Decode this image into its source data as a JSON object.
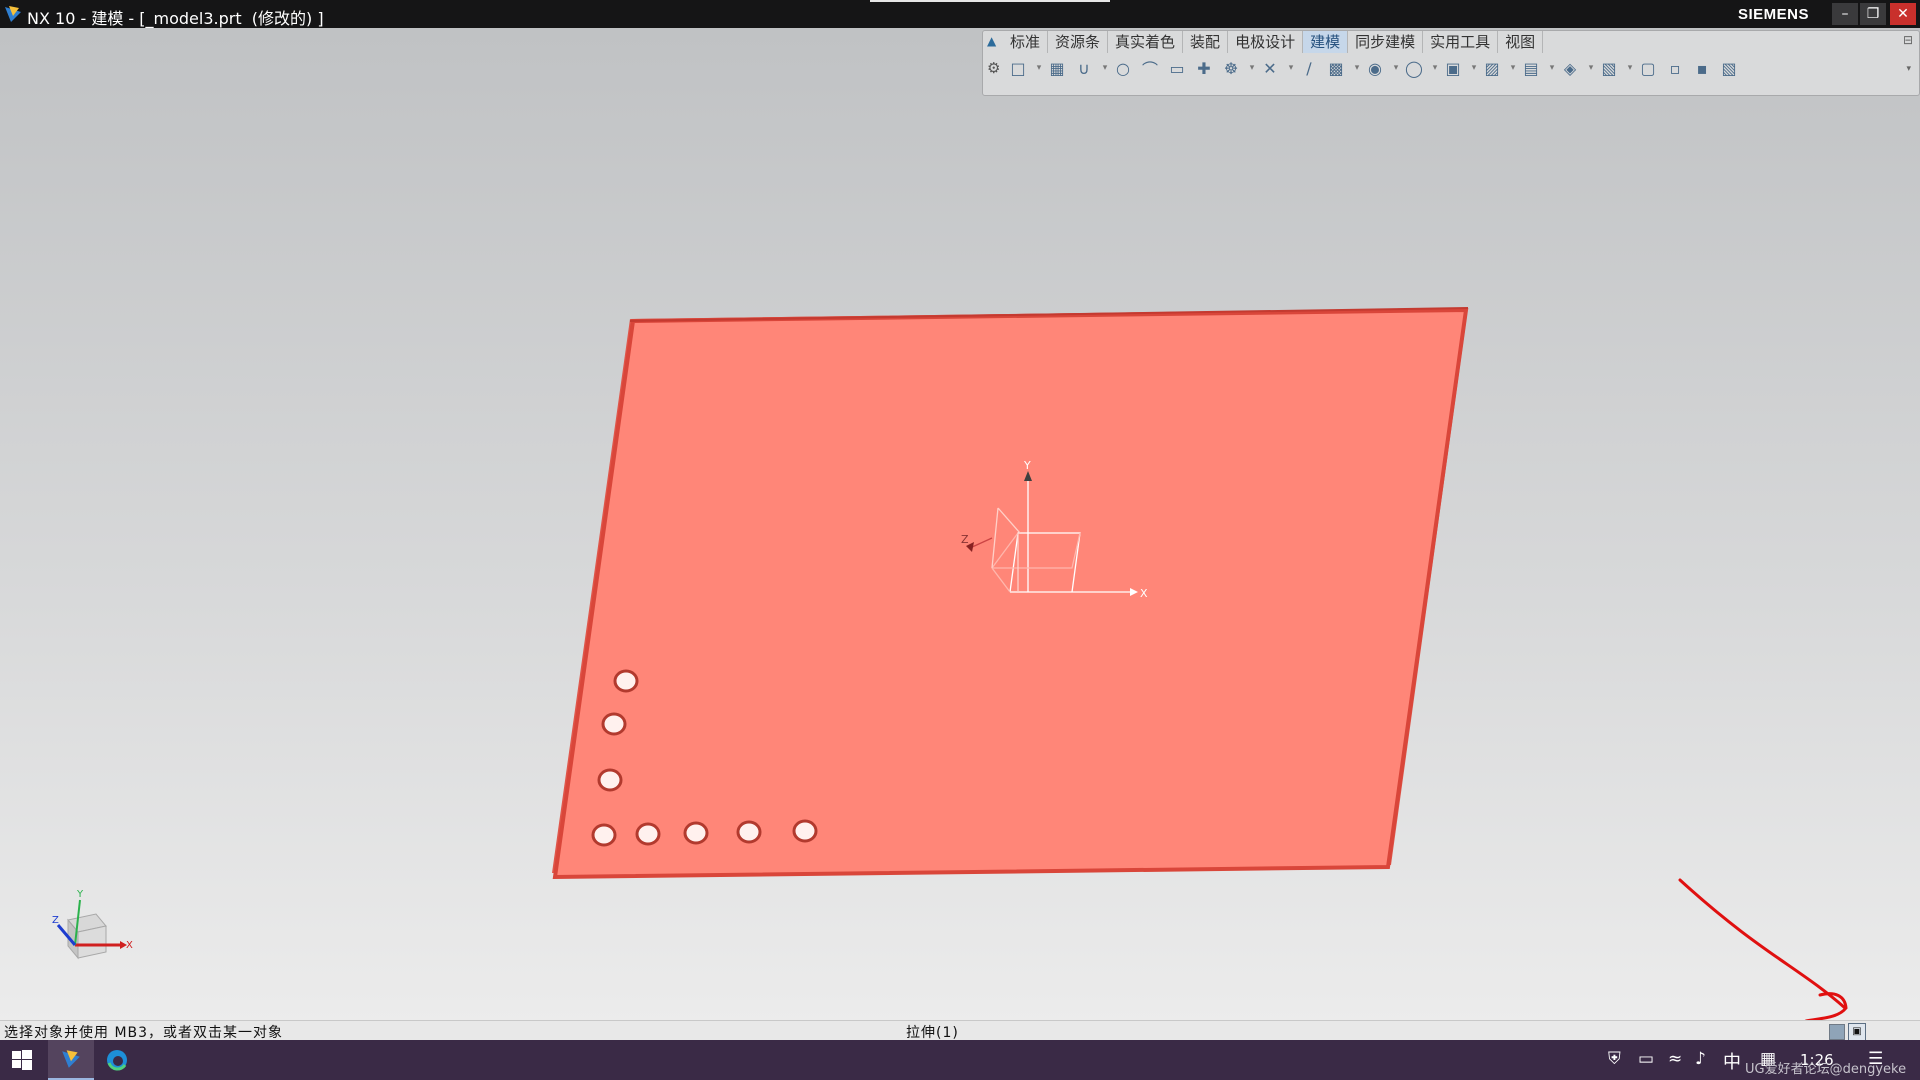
{
  "titlebar": {
    "title": "NX 10 - 建模 - [_model3.prt  (修改的) ]",
    "brand": "SIEMENS",
    "minimize_icon": "minimize-icon",
    "restore_icon": "restore-icon",
    "close_icon": "close-icon"
  },
  "ribbon": {
    "tabs": [
      {
        "label": "标准",
        "active": false
      },
      {
        "label": "资源条",
        "active": false
      },
      {
        "label": "真实着色",
        "active": false
      },
      {
        "label": "装配",
        "active": false
      },
      {
        "label": "电极设计",
        "active": false
      },
      {
        "label": "建模",
        "active": true
      },
      {
        "label": "同步建模",
        "active": false
      },
      {
        "label": "实用工具",
        "active": false
      },
      {
        "label": "视图",
        "active": false
      }
    ],
    "tools": [
      "sketch-icon",
      "datum-icon",
      "arc-icon",
      "circle-icon",
      "fillet-curve-icon",
      "rectangle-icon",
      "point-icon",
      "pattern-icon",
      "trim-icon",
      "sweep-icon",
      "extrude-icon",
      "revolve-icon",
      "hole-icon",
      "boss-icon",
      "block-icon",
      "cylinder-icon",
      "chamfer-icon",
      "shell-icon",
      "unite-icon",
      "subtract-icon",
      "offset-face-icon",
      "draft-icon"
    ]
  },
  "viewport": {
    "plate_color": "#ff8678",
    "plate_edge_color": "#d9463a",
    "wcs_labels": {
      "x": "X",
      "y": "Y",
      "z": "Z"
    },
    "triad_labels": {
      "x": "X",
      "y": "Y",
      "z": "Z"
    },
    "hole_count": 8,
    "annotation_color": "#e01010"
  },
  "statusbar": {
    "prompt": "选择对象并使用 MB3，或者双击某一对象",
    "message": "拉伸(1)"
  },
  "taskbar": {
    "ime": "中",
    "clock": "1:26",
    "watermark": "UG爱好者论坛@dengyeke"
  }
}
